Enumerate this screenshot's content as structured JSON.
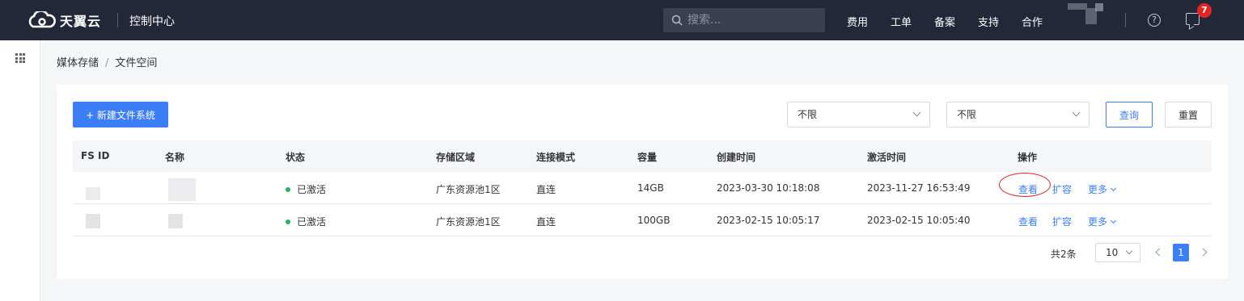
{
  "header": {
    "brand": "天翼云",
    "console": "控制中心",
    "search_placeholder": "搜索...",
    "nav": [
      "费用",
      "工单",
      "备案",
      "支持",
      "合作"
    ],
    "message_count": "7",
    "help_glyph": "?"
  },
  "breadcrumb": {
    "parent": "媒体存储",
    "separator": "/",
    "current": "文件空间"
  },
  "toolbar": {
    "new_button": "+ 新建文件系统",
    "filter1": "不限",
    "filter2": "不限",
    "query_button": "查询",
    "reset_button": "重置"
  },
  "table": {
    "columns": [
      "FS ID",
      "名称",
      "状态",
      "存储区域",
      "连接模式",
      "容量",
      "创建时间",
      "激活时间",
      "操作"
    ],
    "rows": [
      {
        "status": "已激活",
        "region": "广东资源池1区",
        "mode": "直连",
        "capacity": "14GB",
        "created": "2023-03-30 10:18:08",
        "activated": "2023-11-27 16:53:49",
        "view": "查看",
        "expand": "扩容",
        "more": "更多"
      },
      {
        "status": "已激活",
        "region": "广东资源池1区",
        "mode": "直连",
        "capacity": "100GB",
        "created": "2023-02-15 10:05:17",
        "activated": "2023-02-15 10:05:40",
        "view": "查看",
        "expand": "扩容",
        "more": "更多"
      }
    ]
  },
  "pagination": {
    "total": "共2条",
    "page_size": "10",
    "current_page": "1"
  },
  "colors": {
    "primary": "#3b7ef5",
    "topbar": "#232838",
    "status_active": "#22b55a",
    "badge": "#e12525",
    "annotation": "#d9262c"
  }
}
